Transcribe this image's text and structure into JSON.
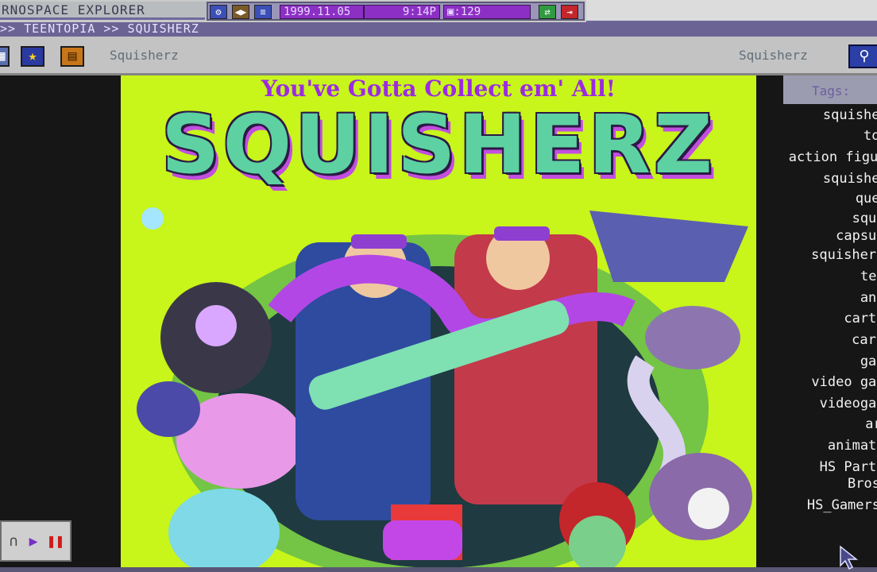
{
  "app": {
    "title": "RNOSPACE EXPLORER"
  },
  "tray": {
    "date": "1999.11.05",
    "time": "9:14P",
    "counter": "▣:129",
    "icons": [
      "settings-gear-icon",
      "back-forward-icon",
      "menu-list-icon",
      "refresh-arrows-icon",
      "exit-icon"
    ]
  },
  "breadcrumb": {
    "text": ">> TEENTOPIA >> SQUISHERZ"
  },
  "toolbar": {
    "page_label_left": "Squisherz",
    "page_label_right": "Squisherz",
    "icons": [
      "grid-icon",
      "star-favorite-icon",
      "bookmark-icon",
      "search-icon"
    ]
  },
  "art": {
    "tagline": "You've Gotta Collect em' All!",
    "title": "SQUISHERZ"
  },
  "tags": {
    "title": "Tags:",
    "items": [
      "squisherz",
      "toys",
      "action figures",
      "squishers",
      "quest",
      "squish",
      "capsules",
      "squisher toy",
      "teen",
      "anime",
      "cartoon",
      "cartoons",
      "games",
      "video games",
      "videogames",
      "art",
      "animation",
      "HS Parties",
      "Bros",
      "HS_Gamers"
    ]
  },
  "player": {
    "icons": [
      "headphones-icon",
      "play-icon",
      "pause-icon"
    ]
  },
  "colors": {
    "accent_purple": "#8c2fc4",
    "art_background": "#c8f51a",
    "title_green": "#5dd1a2",
    "tagline_purple": "#9b2be0"
  }
}
